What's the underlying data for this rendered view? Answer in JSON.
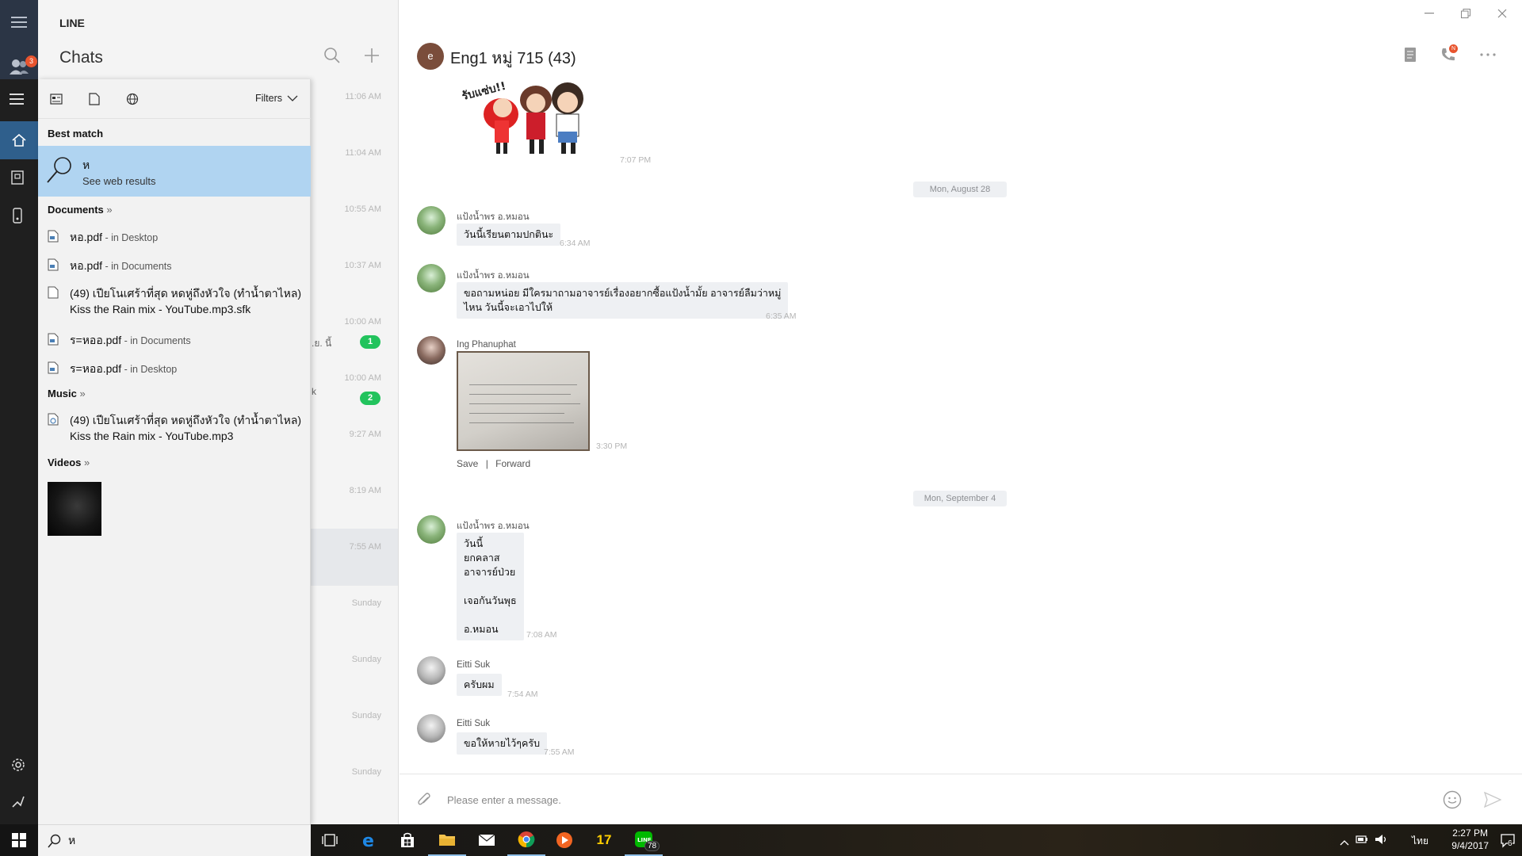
{
  "app": {
    "name": "LINE",
    "rail_badge": "3"
  },
  "chat_list": {
    "title": "Chats",
    "rows": [
      {
        "time": "11:06 AM"
      },
      {
        "time": "11:04 AM"
      },
      {
        "time": "10:55 AM"
      },
      {
        "time": "10:37 AM"
      },
      {
        "time": "10:00 AM",
        "fragment": "ิ.ย. นี้",
        "badge": "1"
      },
      {
        "time": "10:00 AM",
        "fragment": "k",
        "badge": "2"
      },
      {
        "time": "9:27 AM"
      },
      {
        "time": "8:19 AM"
      },
      {
        "time": "7:55 AM"
      },
      {
        "time": "Sunday"
      },
      {
        "time": "Sunday"
      },
      {
        "time": "Sunday"
      },
      {
        "time": "Sunday"
      }
    ]
  },
  "search_flyout": {
    "filters_label": "Filters",
    "best_match": {
      "section": "Best match",
      "query": "ห",
      "subtitle": "See web results"
    },
    "documents": {
      "section": "Documents",
      "more": "»",
      "items": [
        {
          "name": "หอ.pdf",
          "location": " - in Desktop"
        },
        {
          "name": "หอ.pdf",
          "location": " - in Documents"
        },
        {
          "name": "(49) เปียโนเศร้าที่สุด หดหู่ถึงหัวใจ (ทำน้ำตาไหล)",
          "name2": "Kiss the Rain mix - YouTube.mp3.sfk"
        },
        {
          "name": "ร=หออ.pdf",
          "location": " - in Documents"
        },
        {
          "name": "ร=หออ.pdf",
          "location": " - in Desktop"
        }
      ]
    },
    "music": {
      "section": "Music",
      "more": "»",
      "items": [
        {
          "name": "(49) เปียโนเศร้าที่สุด หดหู่ถึงหัวใจ (ทำน้ำตาไหล)",
          "name2": "Kiss the Rain mix - YouTube.mp3"
        }
      ]
    },
    "videos": {
      "section": "Videos",
      "more": "»"
    }
  },
  "conversation": {
    "avatar_letter": "e",
    "title": "Eng1 หมู่ 715 (43)",
    "call_badge": "N",
    "messages": [
      {
        "kind": "sticker",
        "sticker_text": "รับแซ่บ!!",
        "time": "7:07 PM"
      },
      {
        "kind": "date",
        "text": "Mon, August 28"
      },
      {
        "kind": "text",
        "sender": "แป้งน้ำพร อ.หมอน",
        "text": "วันนี้เรียนตามปกตินะ",
        "time": "6:34 AM"
      },
      {
        "kind": "text",
        "sender": "แป้งน้ำพร อ.หมอน",
        "text": "ขอถามหน่อย มีใครมาถามอาจารย์เรื่องอยากซื้อแป้งน้ำมั้ย อาจารย์ลืมว่าหมู่\nไหน วันนี้จะเอาไปให้",
        "time": "6:35 AM"
      },
      {
        "kind": "photo",
        "sender": "Ing Phanuphat",
        "time": "3:30 PM",
        "save": "Save",
        "sep": "|",
        "forward": "Forward"
      },
      {
        "kind": "date",
        "text": "Mon, September 4"
      },
      {
        "kind": "text",
        "sender": "แป้งน้ำพร อ.หมอน",
        "text": "วันนี้\nยกคลาส\nอาจารย์ป่วย\n\nเจอกันวันพุธ\n\nอ.หมอน",
        "time": "7:08 AM"
      },
      {
        "kind": "text",
        "sender": "Eitti Suk",
        "text": "ครับผม",
        "time": "7:54 AM"
      },
      {
        "kind": "text",
        "sender": "Eitti Suk",
        "text": "ขอให้หายไว้ๆครับ",
        "time": "7:55 AM"
      }
    ],
    "composer_placeholder": "Please enter a message."
  },
  "taskbar": {
    "search_value": "ห",
    "app17_label": "17",
    "line_badge": "78",
    "lang": "ไทย",
    "time": "2:27 PM",
    "date": "9/4/2017",
    "notif_count": "6"
  },
  "colors": {
    "rail": "#2b3545",
    "best_match": "#b0d4f1",
    "badge_green": "#22c35d",
    "badge_orange": "#e8542e",
    "bubble": "#eef0f3"
  }
}
